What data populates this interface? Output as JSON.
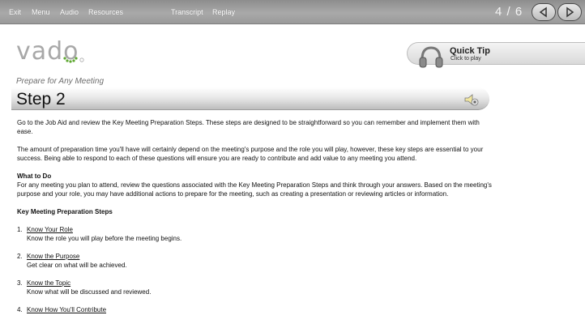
{
  "nav": {
    "exit": "Exit",
    "menu": "Menu",
    "audio": "Audio",
    "resources": "Resources",
    "transcript": "Transcript",
    "replay": "Replay"
  },
  "counter": "4 / 6",
  "icons": {
    "prev": "chevron-left-icon",
    "next": "chevron-right-icon",
    "quick_tip": "headphones-icon",
    "audio": "speaker-icon"
  },
  "logo": {
    "text": "vado"
  },
  "quick_tip": {
    "title": "Quick Tip",
    "subtitle": "Click to play"
  },
  "subtitle": "Prepare for Any Meeting",
  "step_title": "Step 2",
  "content": {
    "intro": "Go to the Job Aid and review the Key Meeting Preparation Steps. These steps are designed to be straightforward so you can remember and implement them with ease.",
    "para2": "The amount of preparation time you'll have will certainly depend on the meeting's purpose and the role you will play, however, these key steps are essential to your success. Being able to respond to each of these questions will ensure you are ready to contribute and add value to any meeting you attend.",
    "what_heading": "What to Do",
    "what_text": "For any meeting you plan to attend, review the questions associated with the Key Meeting Preparation Steps and think through your answers. Based on the meeting's purpose and your role, you may have additional actions to prepare for the meeting, such as creating a presentation or reviewing articles or information.",
    "steps_heading": "Key Meeting Preparation Steps",
    "steps": [
      {
        "num": "1.",
        "title": "Know Your Role",
        "desc": "Know the role you will play before the meeting begins."
      },
      {
        "num": "2.",
        "title": "Know the Purpose",
        "desc": "Get clear on what will be achieved."
      },
      {
        "num": "3.",
        "title": "Know the Topic",
        "desc": "Know what will be discussed and reviewed."
      },
      {
        "num": "4.",
        "title": "Know How You'll Contribute",
        "desc": ""
      }
    ]
  },
  "colors": {
    "topbar": "#9a9a9a",
    "logo": "#a8a8a8",
    "logo_dots": "#5fa832"
  }
}
